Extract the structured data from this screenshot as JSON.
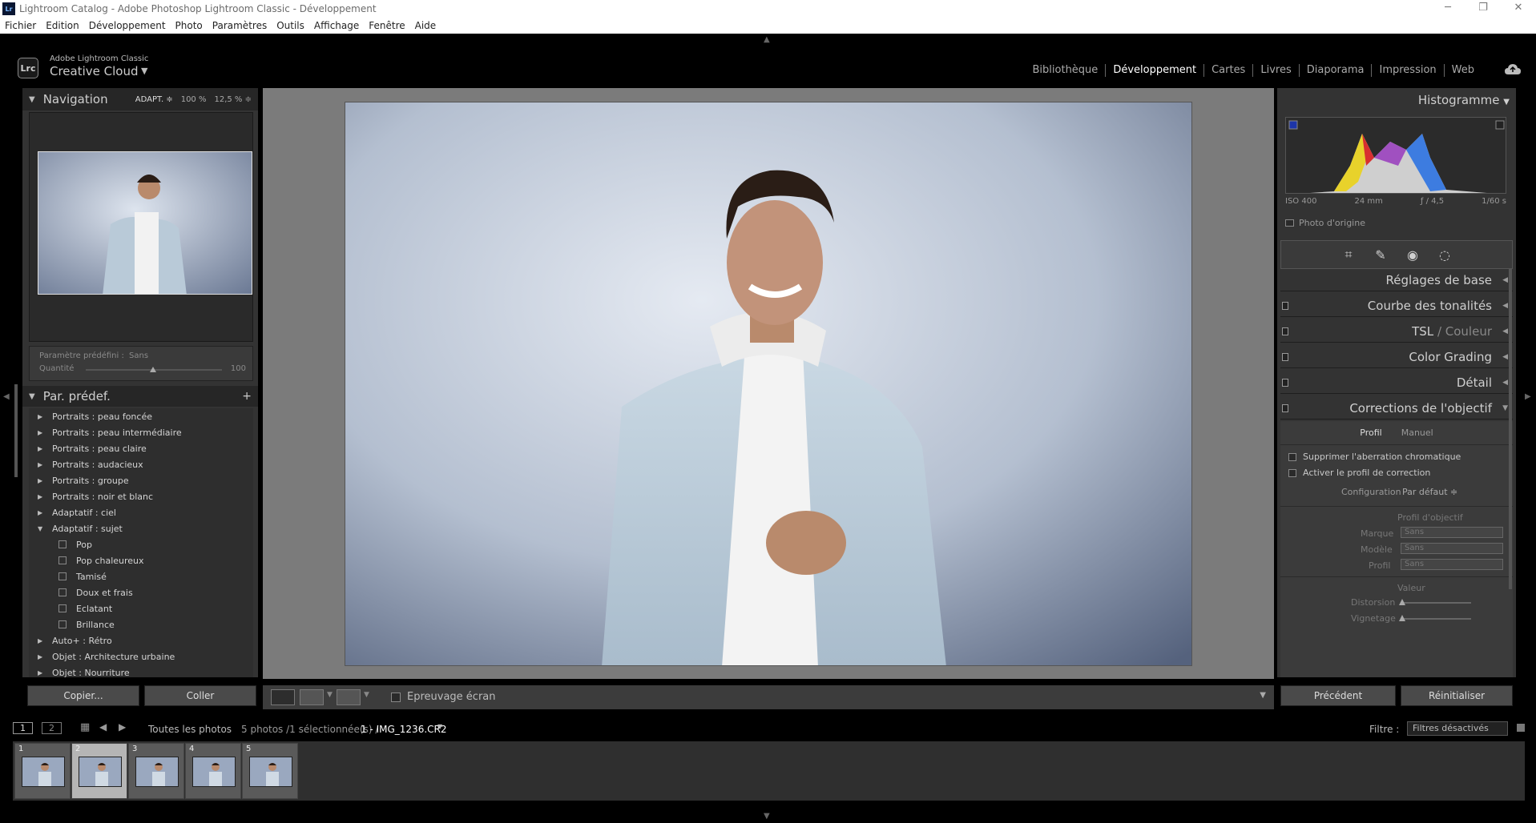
{
  "window": {
    "title": "Lightroom Catalog - Adobe Photoshop Lightroom Classic - Développement",
    "minimize": "─",
    "maximize": "❐",
    "close": "✕"
  },
  "menu": [
    "Fichier",
    "Edition",
    "Développement",
    "Photo",
    "Paramètres",
    "Outils",
    "Affichage",
    "Fenêtre",
    "Aide"
  ],
  "identity": {
    "brand_small": "Adobe Lightroom Classic",
    "brand_big": "Creative Cloud",
    "badge": "Lrc"
  },
  "modules": [
    "Bibliothèque",
    "Développement",
    "Cartes",
    "Livres",
    "Diaporama",
    "Impression",
    "Web"
  ],
  "navigator": {
    "title": "Navigation",
    "zoom": [
      "ADAPT. ≑",
      "100 %",
      "12,5 % ≑"
    ]
  },
  "preset_info": {
    "label": "Paramètre prédéfini :",
    "value": "Sans",
    "amount_label": "Quantité",
    "amount_value": "100"
  },
  "presets": {
    "title": "Par. prédef.",
    "items": [
      {
        "label": "Portraits : peau foncée",
        "open": false
      },
      {
        "label": "Portraits : peau intermédiaire",
        "open": false
      },
      {
        "label": "Portraits : peau claire",
        "open": false
      },
      {
        "label": "Portraits : audacieux",
        "open": false
      },
      {
        "label": "Portraits : groupe",
        "open": false
      },
      {
        "label": "Portraits : noir et blanc",
        "open": false
      },
      {
        "label": "Adaptatif : ciel",
        "open": false
      },
      {
        "label": "Adaptatif : sujet",
        "open": true
      },
      {
        "label": "Pop",
        "child": true
      },
      {
        "label": "Pop chaleureux",
        "child": true
      },
      {
        "label": "Tamisé",
        "child": true
      },
      {
        "label": "Doux et frais",
        "child": true
      },
      {
        "label": "Eclatant",
        "child": true
      },
      {
        "label": "Brillance",
        "child": true
      },
      {
        "label": "Auto+ : Rétro",
        "open": false
      },
      {
        "label": "Objet : Architecture urbaine",
        "open": false
      },
      {
        "label": "Objet : Nourriture",
        "open": false
      }
    ]
  },
  "left_buttons": {
    "copy": "Copier...",
    "paste": "Coller"
  },
  "toolbar": {
    "soft_proof": "Epreuvage écran"
  },
  "histogram": {
    "title": "Histogramme",
    "iso": "ISO 400",
    "focal": "24 mm",
    "aperture": "ƒ / 4,5",
    "shutter": "1/60 s",
    "original": "Photo d'origine"
  },
  "sections": [
    {
      "label": "Réglages de base"
    },
    {
      "label": "Courbe des tonalités"
    },
    {
      "label": "TSL",
      "label2": "Couleur"
    },
    {
      "label": "Color Grading"
    },
    {
      "label": "Détail"
    },
    {
      "label": "Corrections de l'objectif"
    }
  ],
  "lens": {
    "tabs": [
      "Profil",
      "Manuel"
    ],
    "remove_ca": "Supprimer l'aberration chromatique",
    "enable_profile": "Activer le profil de correction",
    "config_label": "Configuration",
    "config_value": "Par défaut ≑",
    "profile_header": "Profil d'objectif",
    "make_label": "Marque",
    "make_value": "Sans",
    "model_label": "Modèle",
    "model_value": "Sans",
    "profile_label": "Profil",
    "profile_value": "Sans",
    "amount_header": "Valeur",
    "distortion_label": "Distorsion",
    "vignetting_label": "Vignetage"
  },
  "right_buttons": {
    "previous": "Précédent",
    "reset": "Réinitialiser"
  },
  "filmbar": {
    "screen1": "1",
    "screen2": "2",
    "source": "Toutes les photos",
    "count": "5 photos /1 sélectionnée(s) /",
    "file": "1 - IMG_1236.CR2",
    "filter_label": "Filtre :",
    "filter_value": "Filtres désactivés"
  },
  "film": [
    "1",
    "2",
    "3",
    "4",
    "5"
  ],
  "colors": {
    "panel": "#333333",
    "accent": "#ffffff",
    "background": "#7b7b7b"
  }
}
